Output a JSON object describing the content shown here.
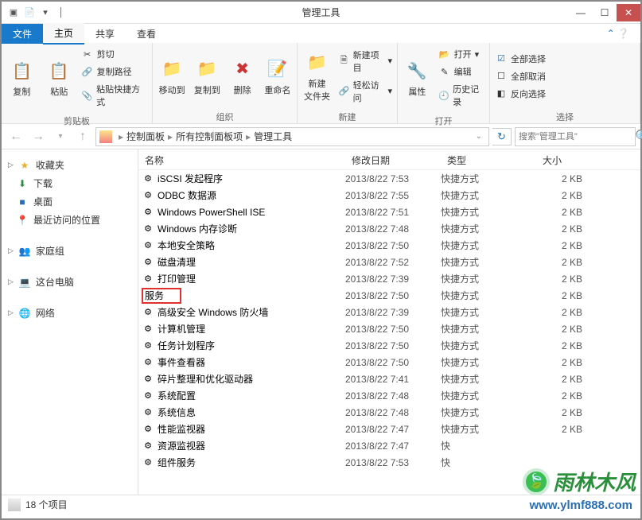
{
  "window": {
    "title": "管理工具"
  },
  "tabs": {
    "file": "文件",
    "home": "主页",
    "share": "共享",
    "view": "查看"
  },
  "ribbon": {
    "copy": "复制",
    "paste": "粘贴",
    "cut": "剪切",
    "copypath": "复制路径",
    "pasteshortcut": "粘贴快捷方式",
    "moveto": "移动到",
    "copyto": "复制到",
    "delete": "删除",
    "rename": "重命名",
    "newfolder": "新建\n文件夹",
    "newitem": "新建项目",
    "easyaccess": "轻松访问",
    "properties": "属性",
    "open": "打开",
    "edit": "编辑",
    "history": "历史记录",
    "selectall": "全部选择",
    "selectnone": "全部取消",
    "invert": "反向选择",
    "group_clipboard": "剪贴板",
    "group_organize": "组织",
    "group_new": "新建",
    "group_open": "打开",
    "group_select": "选择"
  },
  "breadcrumb": {
    "a": "控制面板",
    "b": "所有控制面板项",
    "c": "管理工具"
  },
  "search": {
    "placeholder": "搜索\"管理工具\""
  },
  "sidebar": {
    "favorites": "收藏夹",
    "downloads": "下载",
    "desktop": "桌面",
    "recent": "最近访问的位置",
    "homegroup": "家庭组",
    "thispc": "这台电脑",
    "network": "网络"
  },
  "columns": {
    "name": "名称",
    "date": "修改日期",
    "type": "类型",
    "size": "大小"
  },
  "files": [
    {
      "name": "iSCSI 发起程序",
      "date": "2013/8/22 7:53",
      "type": "快捷方式",
      "size": "2 KB"
    },
    {
      "name": "ODBC 数据源",
      "date": "2013/8/22 7:55",
      "type": "快捷方式",
      "size": "2 KB"
    },
    {
      "name": "Windows PowerShell ISE",
      "date": "2013/8/22 7:51",
      "type": "快捷方式",
      "size": "2 KB"
    },
    {
      "name": "Windows 内存诊断",
      "date": "2013/8/22 7:48",
      "type": "快捷方式",
      "size": "2 KB"
    },
    {
      "name": "本地安全策略",
      "date": "2013/8/22 7:50",
      "type": "快捷方式",
      "size": "2 KB"
    },
    {
      "name": "磁盘清理",
      "date": "2013/8/22 7:52",
      "type": "快捷方式",
      "size": "2 KB"
    },
    {
      "name": "打印管理",
      "date": "2013/8/22 7:39",
      "type": "快捷方式",
      "size": "2 KB"
    },
    {
      "name": "服务",
      "date": "2013/8/22 7:50",
      "type": "快捷方式",
      "size": "2 KB",
      "hl": true
    },
    {
      "name": "高级安全 Windows 防火墙",
      "date": "2013/8/22 7:39",
      "type": "快捷方式",
      "size": "2 KB"
    },
    {
      "name": "计算机管理",
      "date": "2013/8/22 7:50",
      "type": "快捷方式",
      "size": "2 KB"
    },
    {
      "name": "任务计划程序",
      "date": "2013/8/22 7:50",
      "type": "快捷方式",
      "size": "2 KB"
    },
    {
      "name": "事件查看器",
      "date": "2013/8/22 7:50",
      "type": "快捷方式",
      "size": "2 KB"
    },
    {
      "name": "碎片整理和优化驱动器",
      "date": "2013/8/22 7:41",
      "type": "快捷方式",
      "size": "2 KB"
    },
    {
      "name": "系统配置",
      "date": "2013/8/22 7:48",
      "type": "快捷方式",
      "size": "2 KB"
    },
    {
      "name": "系统信息",
      "date": "2013/8/22 7:48",
      "type": "快捷方式",
      "size": "2 KB"
    },
    {
      "name": "性能监视器",
      "date": "2013/8/22 7:47",
      "type": "快捷方式",
      "size": "2 KB"
    },
    {
      "name": "资源监视器",
      "date": "2013/8/22 7:47",
      "type": "快",
      "size": ""
    },
    {
      "name": "组件服务",
      "date": "2013/8/22 7:53",
      "type": "快",
      "size": ""
    }
  ],
  "status": {
    "count": "18 个项目"
  },
  "watermark": {
    "text": "雨林木风",
    "url": "www.ylmf888.com"
  }
}
